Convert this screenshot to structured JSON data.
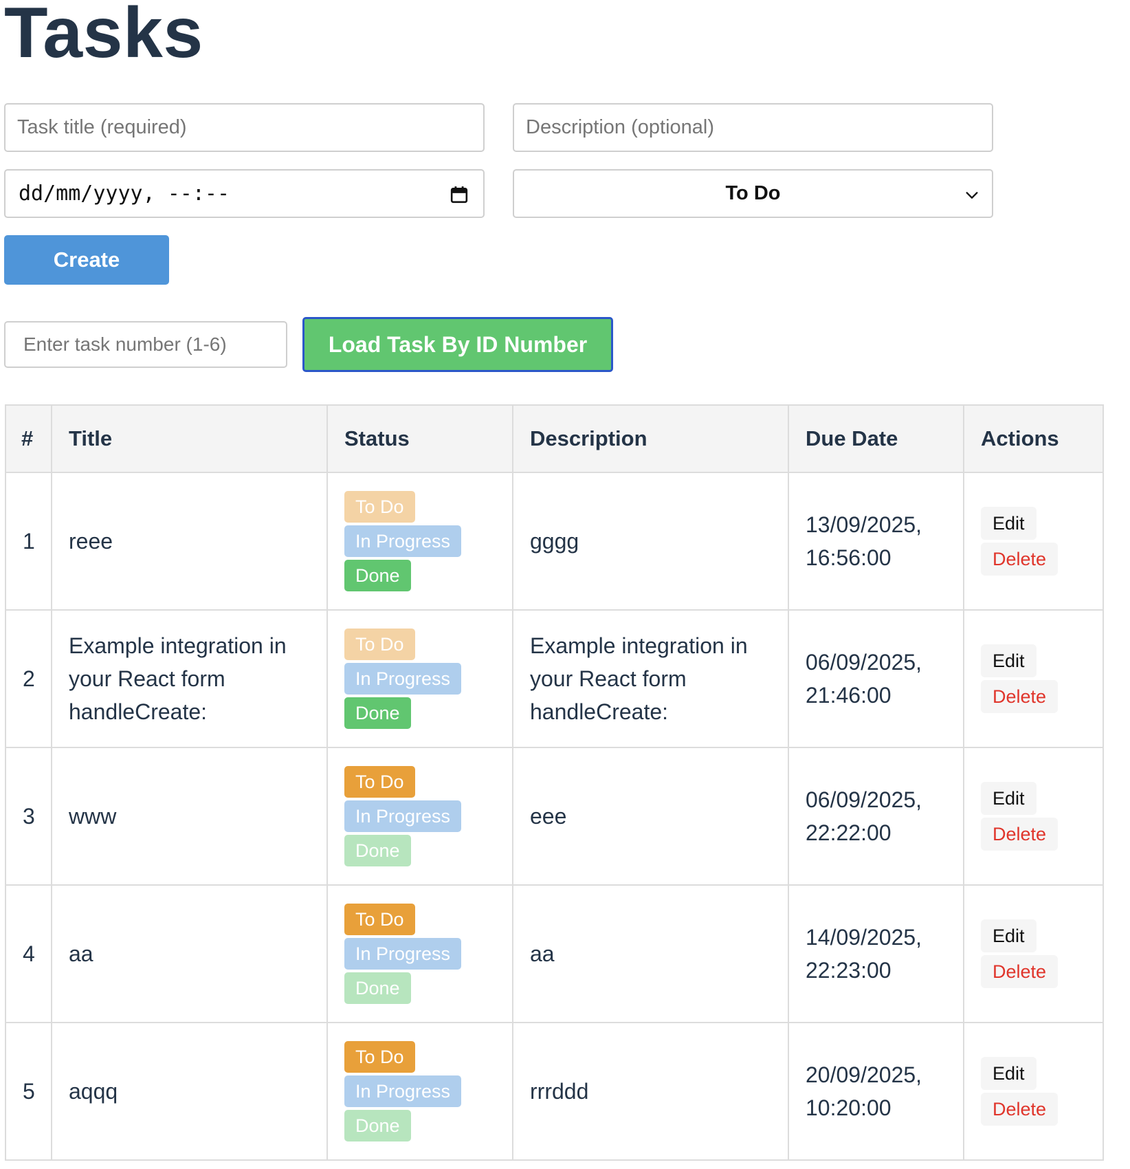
{
  "page": {
    "title": "Tasks"
  },
  "form": {
    "title_placeholder": "Task title (required)",
    "description_placeholder": "Description (optional)",
    "due_placeholder": "dd/mm/yyyy, --:--",
    "status_selected": "To Do",
    "create_label": "Create"
  },
  "loader": {
    "number_placeholder": "Enter task number (1-6)",
    "load_label": "Load Task By ID Number"
  },
  "table": {
    "headers": {
      "num": "#",
      "title": "Title",
      "status": "Status",
      "description": "Description",
      "due": "Due Date",
      "actions": "Actions"
    },
    "status_labels": {
      "todo": "To Do",
      "in_progress": "In Progress",
      "done": "Done"
    },
    "action_labels": {
      "edit": "Edit",
      "delete": "Delete"
    },
    "rows": [
      {
        "num": "1",
        "title": "reee",
        "status": "done",
        "description": "gggg",
        "due_line1": "13/09/2025,",
        "due_line2": "16:56:00"
      },
      {
        "num": "2",
        "title": "Example integration in your React form handleCreate:",
        "status": "done",
        "description": "Example integration in your React form handleCreate:",
        "due_line1": "06/09/2025,",
        "due_line2": "21:46:00"
      },
      {
        "num": "3",
        "title": "www",
        "status": "todo",
        "description": "eee",
        "due_line1": "06/09/2025,",
        "due_line2": "22:22:00"
      },
      {
        "num": "4",
        "title": "aa",
        "status": "todo",
        "description": "aa",
        "due_line1": "14/09/2025,",
        "due_line2": "22:23:00"
      },
      {
        "num": "5",
        "title": "aqqq",
        "status": "todo",
        "description": "rrrddd",
        "due_line1": "20/09/2025,",
        "due_line2": "10:20:00"
      }
    ]
  },
  "colors": {
    "heading": "#243447",
    "create_button": "#4f95d9",
    "load_button": "#61c670",
    "load_button_border": "#2b57c9",
    "status_todo": "#e8a03a",
    "status_in_progress": "#4f95d9",
    "status_done": "#61c670",
    "delete_text": "#e0352b"
  },
  "icons": {
    "date_picker": "calendar-icon",
    "select": "chevron-down-icon"
  }
}
